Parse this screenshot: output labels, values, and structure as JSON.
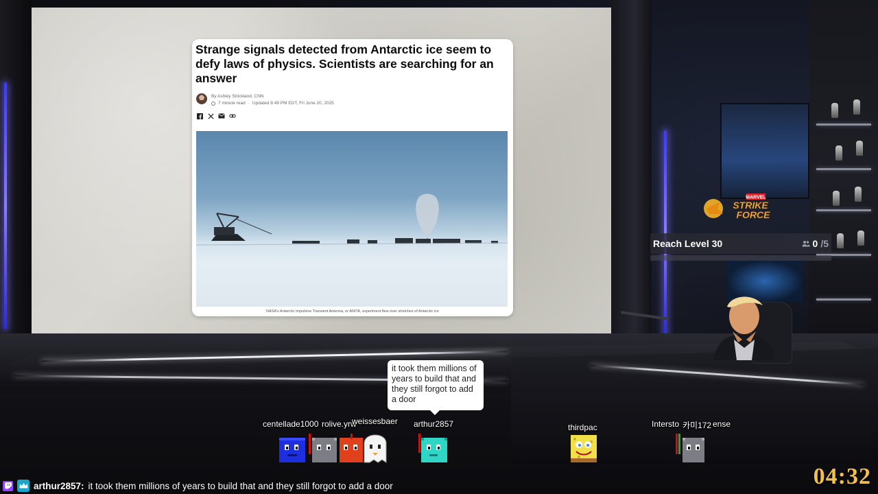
{
  "article": {
    "headline": "Strange signals detected from Antarctic ice seem to defy laws of physics. Scientists are searching for an answer",
    "byline": "By Ashley Strickland, CNN",
    "read_time": "7 minute read",
    "updated": "Updated 8:49 PM EDT, Fri June 20, 2025",
    "share_icons": [
      "facebook-icon",
      "x-icon",
      "email-icon",
      "link-icon"
    ],
    "photo_caption": "NASA's Antarctic Impulsive Transient Antenna, or ANITA, experiment flew over stretches of Antarctic ice"
  },
  "overlay": {
    "game_logo_top": "MARVEL",
    "game_logo_line1": "STRIKE",
    "game_logo_line2": "FORCE",
    "goal_label": "Reach Level 30",
    "goal_current": "0",
    "goal_total": "/5",
    "goal_fraction": 0.0,
    "timer": "04:32"
  },
  "chatters": {
    "bubble_text": "it took them millions of years to build that and they still forgot to add a door",
    "names": [
      "centellade1000",
      "rolive.yrw",
      "weissesbaer",
      "arthur2857",
      "thirdpac",
      "Intersto",
      "카미172",
      "ense"
    ]
  },
  "chat": {
    "user": "arthur2857:",
    "message": "it took them millions of years to build that and they still forgot to add a door"
  },
  "colors": {
    "timer": "#f1c04b",
    "goal_bar": "#e9c44d",
    "twitch": "#9146ff"
  }
}
